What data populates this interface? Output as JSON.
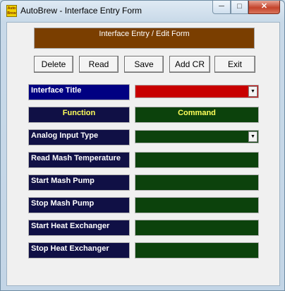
{
  "window": {
    "title": "AutoBrew - Interface Entry Form",
    "app_icon_text": "Auto Brew",
    "icon": "autobrew-app-icon",
    "controls": {
      "minimize": "─",
      "maximize": "□",
      "close": "✕"
    }
  },
  "form": {
    "header": "Interface Entry / Edit Form",
    "buttons": {
      "delete": "Delete",
      "read": "Read",
      "save": "Save",
      "add_cr": "Add CR",
      "exit": "Exit"
    },
    "interface_title_label": "Interface Title",
    "function_header": "Function",
    "command_header": "Command",
    "analog_input_type_label": "Analog Input Type",
    "rows": [
      {
        "label": "Read Mash Temperature",
        "command": ""
      },
      {
        "label": "Start Mash Pump",
        "command": ""
      },
      {
        "label": "Stop Mash Pump",
        "command": ""
      },
      {
        "label": "Start Heat Exchanger",
        "command": ""
      },
      {
        "label": "Stop Heat Exchanger",
        "command": ""
      }
    ],
    "dropdown_icon": "▼"
  },
  "colors": {
    "header_bg": "#7a3e00",
    "label_bg": "#101045",
    "label_blue_bg": "#000082",
    "field_green": "#0c420c",
    "field_red": "#c80000",
    "header_text_yellow": "#ffff5a"
  }
}
